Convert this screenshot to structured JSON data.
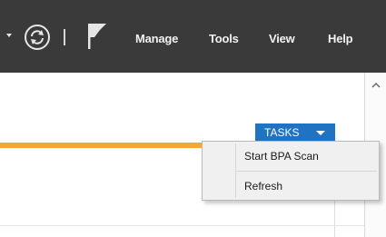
{
  "toolbar": {
    "refresh_icon": "refresh-icon",
    "flag_icon": "flag-icon",
    "menu": [
      "Manage",
      "Tools",
      "View",
      "Help"
    ]
  },
  "tasks": {
    "label": "TASKS"
  },
  "context_menu": {
    "items": [
      "Start BPA Scan",
      "Refresh"
    ]
  },
  "colors": {
    "titlebar": "#3a3a3a",
    "tasks_button": "#1f73c1",
    "accent_bar": "#f3a833"
  }
}
